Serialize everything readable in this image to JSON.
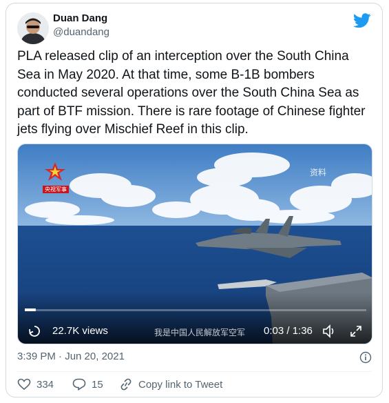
{
  "author": {
    "name": "Duan Dang",
    "handle": "@duandang",
    "avatar": "avatar-icon"
  },
  "tweet": {
    "text": "PLA released clip of an interception over the South China Sea in May 2020. At that time, some B-1B bombers conducted several operations over the South China Sea as part of BTF mission. There is rare footage of Chinese fighter jets flying over Mischief Reef in this clip.",
    "timestamp": "3:39 PM · Jun 20, 2021"
  },
  "video": {
    "watermark": "资料",
    "channel_logo_text": "央视军事",
    "views": "22.7K views",
    "caption": "我是中国人民解放军空军",
    "time": "0:03 / 1:36",
    "progress": 0.031
  },
  "actions": {
    "likes": "334",
    "replies": "15",
    "copy_link": "Copy link to Tweet"
  },
  "colors": {
    "brand": "#1d9bf0",
    "secondary_text": "#536471",
    "border": "#cfd9de"
  }
}
